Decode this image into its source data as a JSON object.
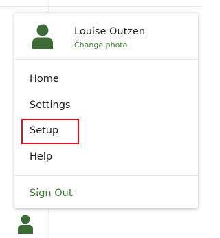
{
  "profile": {
    "name": "Louise Outzen",
    "change_photo": "Change photo",
    "avatar_icon": "user-avatar-icon"
  },
  "menu": {
    "items": [
      {
        "label": "Home"
      },
      {
        "label": "Settings"
      },
      {
        "label": "Setup",
        "highlighted": true
      },
      {
        "label": "Help"
      }
    ],
    "sign_out": "Sign Out"
  },
  "colors": {
    "accent": "#3e7a36",
    "avatar": "#3d6b37",
    "highlight": "#e0101c"
  },
  "footer": {
    "avatar_icon": "user-avatar-icon"
  }
}
